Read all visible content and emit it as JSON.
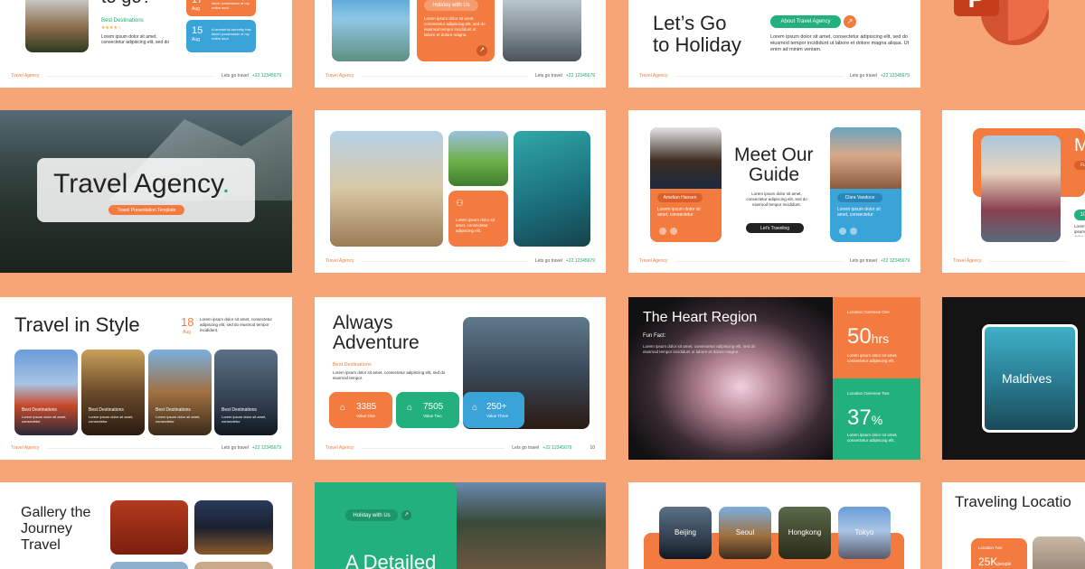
{
  "footer": {
    "brand": "Travel Agency",
    "tagline": "Lets go travel",
    "phone": "+22 12345679"
  },
  "s1": {
    "title_fragment": "to go?",
    "section": "Best Destinations",
    "stars": "★★★★☆",
    "body": "Lorem ipsum dolor sit amet, consectetur adipiscing elit, sed do",
    "date1_num": "17",
    "date1_mon": "Aug",
    "date1_text": "A wonderful serenity has taken possession of my entire soul",
    "date2_num": "15",
    "date2_mon": "Aug",
    "date2_text": "A wonderful serenity has taken possession of my entire soul"
  },
  "s2": {
    "pill": "Holiday with Us",
    "body": "Lorem ipsum dolor sit amet, consectetur adipiscing elit, sed do eiusmod tempor incididunt ut labore et dolore magna."
  },
  "s3": {
    "title1": "Let’s Go",
    "title2": "to Holiday",
    "pill": "About Travel Agency",
    "body": "Lorem ipsum dolor sit amet, consectetur adipiscing elit, sed do eiusmod tempor incididunt ut labore et dolore magna aliqua. Ut enim ad minim veniam."
  },
  "s4": {
    "title": "Travel Agency",
    "dot": ".",
    "subtitle": "Travel Presentation Template"
  },
  "s5": {
    "card_text": "Lorem ipsum dolor sit amet, consectetur adipiscing elit."
  },
  "s6": {
    "title1": "Meet Our",
    "title2": "Guide",
    "body": "Lorem ipsum dolor sit amet, consectetur adipiscing elit, sed do eiusmod tempor incididunt.",
    "button": "Let's Traveling",
    "guide1": "Amelian Hansen",
    "guide2": "Clara Vandoce",
    "guide_text": "Lorem ipsum dolor sit amet, consectetur"
  },
  "s7": {
    "title": "M",
    "body": "Lorem ipsum dolor sit amet",
    "label": "Fu",
    "num": "10"
  },
  "s8": {
    "title": "Travel in Style",
    "date_num": "18",
    "date_mon": "Aug",
    "body": "Lorem ipsum dolor sit amet, consectetur adipiscing elit, sed do eiusmod tempor incididunt.",
    "cards": [
      {
        "label": "Best Destinations",
        "text": "Lorem ipsum dolor sit amet, consectetur"
      },
      {
        "label": "Best Destinations",
        "text": "Lorem ipsum dolor sit amet, consectetur"
      },
      {
        "label": "Best Destinations",
        "text": "Lorem ipsum dolor sit amet, consectetur"
      },
      {
        "label": "Best Destinations",
        "text": "Lorem ipsum dolor sit amet, consectetur"
      }
    ]
  },
  "s9": {
    "title1": "Always",
    "title2": "Adventure",
    "section": "Best Destinations",
    "body": "Lorem ipsum dolor sit amet, consectetur adipiscing elit, sed do eiusmod tempor.",
    "stats": [
      {
        "value": "3385",
        "label": "Value One"
      },
      {
        "value": "7505",
        "label": "Value Two"
      },
      {
        "value": "250+",
        "label": "Value Three"
      }
    ],
    "page": "10"
  },
  "s10": {
    "title": "The Heart Region",
    "fun": "Fun Fact:",
    "body": "Lorem ipsum dolor sit amet, consectetur adipiscing elit, sed do eiusmod tempor incididunt ut labore et dolore magna.",
    "ov1": "Location Overview One",
    "v1": "50",
    "u1": "hrs",
    "ov2": "Location Overview Two",
    "v2": "37",
    "u2": "%",
    "stat_text": "Lorem ipsum dolor sit amet, consectetur adipiscing elit."
  },
  "s11": {
    "title": "Maldives"
  },
  "s12": {
    "title1": "Gallery the",
    "title2": "Journey",
    "title3": "Travel"
  },
  "s13": {
    "pill": "Holiday with Us",
    "title": "A Detailed"
  },
  "s14": {
    "cities": [
      "Beijing",
      "Seoul",
      "Hongkong",
      "Tokyo"
    ]
  },
  "s15": {
    "title": "Traveling Locatio",
    "ov": "Location Two",
    "value": "25K",
    "unit": "people"
  },
  "app": {
    "letter": "P"
  }
}
